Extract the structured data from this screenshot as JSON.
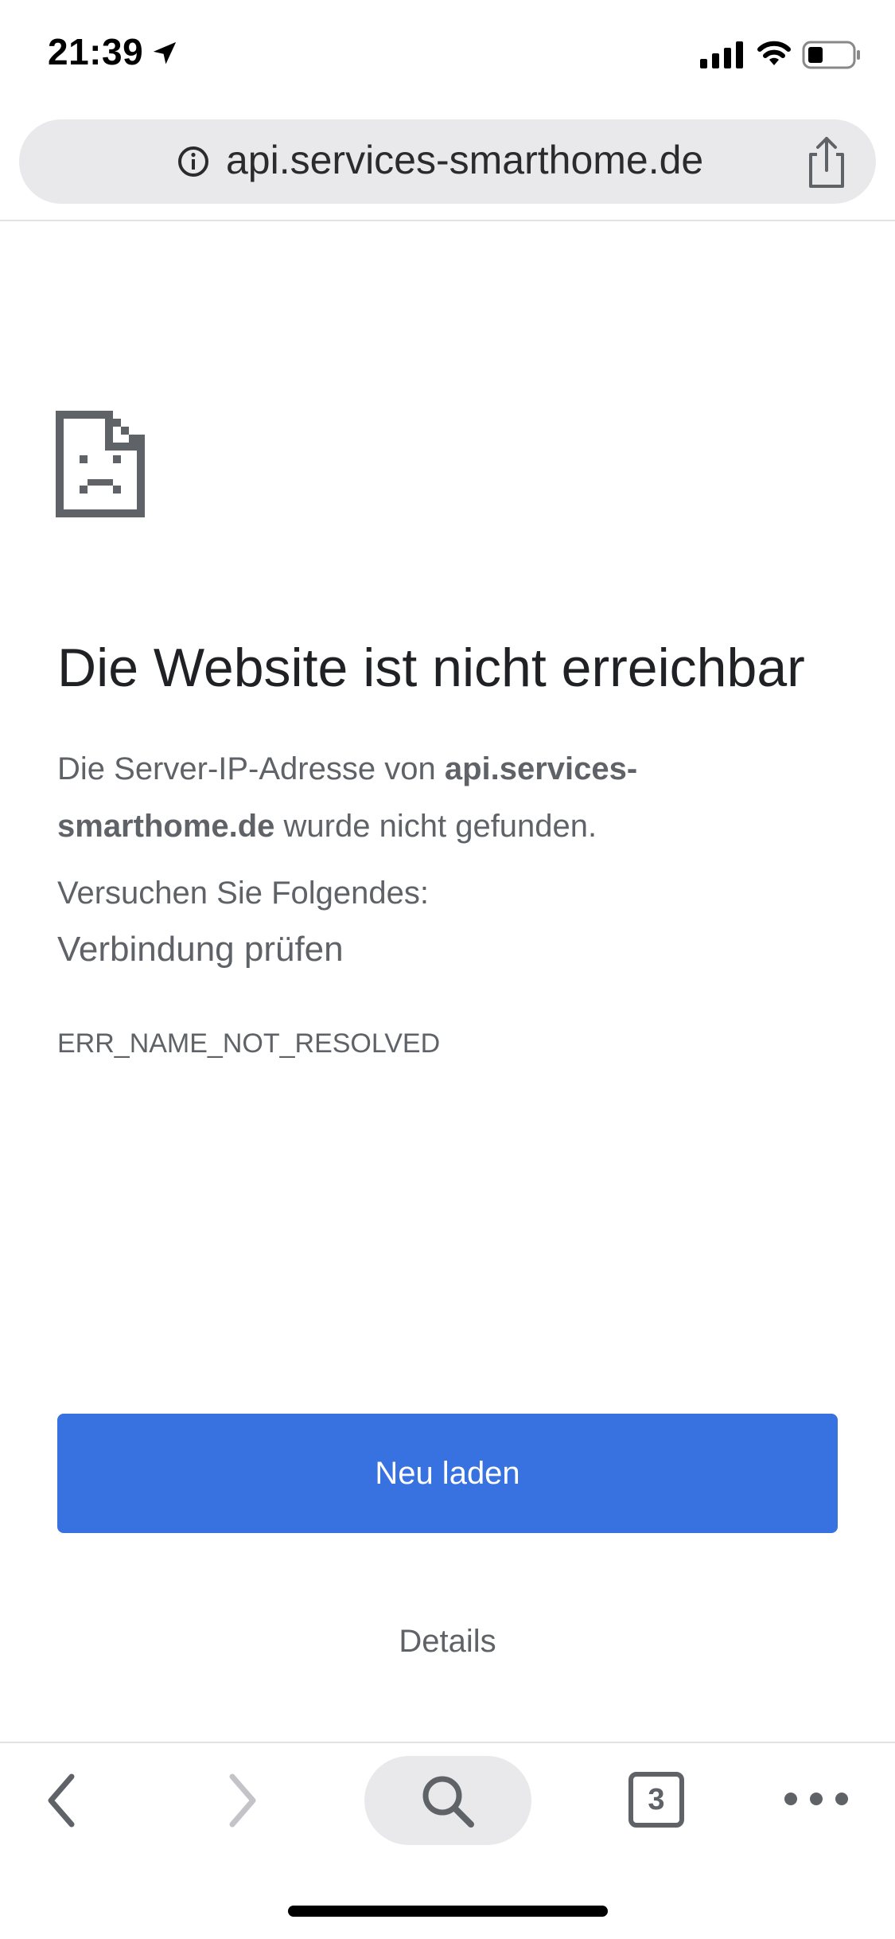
{
  "status_bar": {
    "time": "21:39"
  },
  "url_bar": {
    "url": "api.services-smarthome.de"
  },
  "error": {
    "title": "Die Website ist nicht erreichbar",
    "desc_prefix": "Die Server-IP-Adresse von ",
    "desc_host": "api.services-smarthome.de",
    "desc_suffix": " wurde nicht gefunden.",
    "suggest_heading": "Versuchen Sie Folgendes:",
    "suggest_item": "Verbindung prüfen",
    "code": "ERR_NAME_NOT_RESOLVED"
  },
  "actions": {
    "reload_label": "Neu laden",
    "details_label": "Details"
  },
  "toolbar": {
    "tab_count": "3"
  },
  "colors": {
    "accent": "#3872e0",
    "url_bar_bg": "#e9e9ec",
    "text_secondary": "#5f6368",
    "text_primary": "#202124"
  },
  "icons": [
    "location-arrow-icon",
    "cellular-signal-icon",
    "wifi-icon",
    "battery-icon",
    "info-icon",
    "share-icon",
    "sad-page-icon",
    "back-arrow-icon",
    "forward-arrow-icon",
    "search-icon",
    "tabs-icon",
    "more-icon"
  ]
}
